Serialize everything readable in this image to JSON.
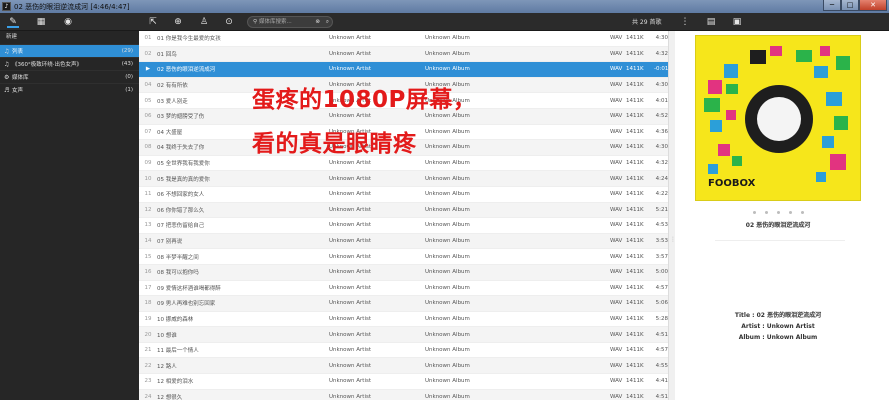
{
  "window": {
    "title": "02 恶伤的眼泪逆流成河 [4:46/4:47]",
    "minimize": "─",
    "maximize": "□",
    "close": "✕"
  },
  "toolbar": {
    "search_placeholder": "媒体库搜索...",
    "song_count": "共 29 首歌"
  },
  "sidebar": {
    "new_label": "新建",
    "playlists": [
      {
        "name": "列表",
        "count": "(29)",
        "active": true
      },
      {
        "name": "《360°极致环绕·出色女声》",
        "count": "(43)",
        "active": false
      },
      {
        "name": "媒体库",
        "count": "(0)",
        "active": false
      },
      {
        "name": "女声",
        "count": "(1)",
        "active": false
      }
    ]
  },
  "tracks": [
    {
      "idx": "01",
      "title": "01 你是我今生最爱的女孩",
      "artist": "Unknown Artist",
      "album": "Unknown Album",
      "fmt": "WAV",
      "rate": "1411K",
      "dur": "4:30"
    },
    {
      "idx": "02",
      "title": "01 回鸟",
      "artist": "Unknown Artist",
      "album": "Unknown Album",
      "fmt": "WAV",
      "rate": "1411K",
      "dur": "4:32"
    },
    {
      "idx": "▶",
      "title": "02 恶伤的眼泪逆流成河",
      "artist": "Unknown Artist",
      "album": "Unknown Album",
      "fmt": "WAV",
      "rate": "1411K",
      "dur": "-0:01",
      "playing": true
    },
    {
      "idx": "04",
      "title": "02 有有所依",
      "artist": "Unknown Artist",
      "album": "Unknown Album",
      "fmt": "WAV",
      "rate": "1411K",
      "dur": "4:30"
    },
    {
      "idx": "05",
      "title": "03 爱人别走",
      "artist": "Unknown Artist",
      "album": "Unknown Album",
      "fmt": "WAV",
      "rate": "1411K",
      "dur": "4:01"
    },
    {
      "idx": "06",
      "title": "03 梦的翅膀受了伤",
      "artist": "Unknown Artist",
      "album": "Unknown Album",
      "fmt": "WAV",
      "rate": "1411K",
      "dur": "4:52"
    },
    {
      "idx": "07",
      "title": "04 大盛屋",
      "artist": "Unknown Artist",
      "album": "Unknown Album",
      "fmt": "WAV",
      "rate": "1411K",
      "dur": "4:36"
    },
    {
      "idx": "08",
      "title": "04 我终于失去了你",
      "artist": "Unknown Artist",
      "album": "Unknown Album",
      "fmt": "WAV",
      "rate": "1411K",
      "dur": "4:30"
    },
    {
      "idx": "09",
      "title": "05 全世界我有我爱你",
      "artist": "Unknown Artist",
      "album": "Unknown Album",
      "fmt": "WAV",
      "rate": "1411K",
      "dur": "4:32"
    },
    {
      "idx": "10",
      "title": "05 我是真的真的爱你",
      "artist": "Unknown Artist",
      "album": "Unknown Album",
      "fmt": "WAV",
      "rate": "1411K",
      "dur": "4:24"
    },
    {
      "idx": "11",
      "title": "06 不想回家的女人",
      "artist": "Unknown Artist",
      "album": "Unknown Album",
      "fmt": "WAV",
      "rate": "1411K",
      "dur": "4:22"
    },
    {
      "idx": "12",
      "title": "06 你你错了那么久",
      "artist": "Unknown Artist",
      "album": "Unknown Album",
      "fmt": "WAV",
      "rate": "1411K",
      "dur": "5:21"
    },
    {
      "idx": "13",
      "title": "07 把悲伤留给自己",
      "artist": "Unknown Artist",
      "album": "Unknown Album",
      "fmt": "WAV",
      "rate": "1411K",
      "dur": "4:53"
    },
    {
      "idx": "14",
      "title": "07 别再说",
      "artist": "Unknown Artist",
      "album": "Unknown Album",
      "fmt": "WAV",
      "rate": "1411K",
      "dur": "3:53"
    },
    {
      "idx": "15",
      "title": "08 半梦半醒之间",
      "artist": "Unknown Artist",
      "album": "Unknown Album",
      "fmt": "WAV",
      "rate": "1411K",
      "dur": "3:57"
    },
    {
      "idx": "16",
      "title": "08 我可以抱你吗",
      "artist": "Unknown Artist",
      "album": "Unknown Album",
      "fmt": "WAV",
      "rate": "1411K",
      "dur": "5:00"
    },
    {
      "idx": "17",
      "title": "09 爱情这杯酒谁喝都得醉",
      "artist": "Unknown Artist",
      "album": "Unknown Album",
      "fmt": "WAV",
      "rate": "1411K",
      "dur": "4:57"
    },
    {
      "idx": "18",
      "title": "09 男人再难也别忘回家",
      "artist": "Unknown Artist",
      "album": "Unknown Album",
      "fmt": "WAV",
      "rate": "1411K",
      "dur": "5:06"
    },
    {
      "idx": "19",
      "title": "10 挪威的森林",
      "artist": "Unknown Artist",
      "album": "Unknown Album",
      "fmt": "WAV",
      "rate": "1411K",
      "dur": "5:28"
    },
    {
      "idx": "20",
      "title": "10 想谁",
      "artist": "Unknown Artist",
      "album": "Unknown Album",
      "fmt": "WAV",
      "rate": "1411K",
      "dur": "4:51"
    },
    {
      "idx": "21",
      "title": "11 最后一个情人",
      "artist": "Unknown Artist",
      "album": "Unknown Album",
      "fmt": "WAV",
      "rate": "1411K",
      "dur": "4:57"
    },
    {
      "idx": "22",
      "title": "12 路人",
      "artist": "Unknown Artist",
      "album": "Unknown Album",
      "fmt": "WAV",
      "rate": "1411K",
      "dur": "4:55"
    },
    {
      "idx": "23",
      "title": "12 相爱的泪水",
      "artist": "Unknown Artist",
      "album": "Unknown Album",
      "fmt": "WAV",
      "rate": "1411K",
      "dur": "4:41"
    },
    {
      "idx": "24",
      "title": "12 想很久",
      "artist": "Unknown Artist",
      "album": "Unknown Album",
      "fmt": "WAV",
      "rate": "1411K",
      "dur": "4:51"
    }
  ],
  "overlay": {
    "line1": "蛋疼的1080P屏幕，",
    "line2": "看的真是眼睛疼"
  },
  "nowplaying": {
    "cover_logo": "FOOBOX",
    "title": "02 恶伤的眼泪逆流成河",
    "meta_title": "Title : 02 恶伤的眼泪逆流成河",
    "meta_artist": "Artist : Unkown Artist",
    "meta_album": "Album : Unkown Album"
  },
  "colors": {
    "accent": "#2f8fd6",
    "overlay_text": "#e31a1a",
    "cover_bg": "#f6e61b"
  }
}
